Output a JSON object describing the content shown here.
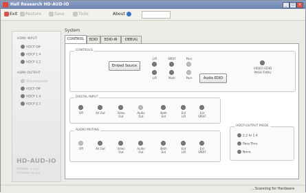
{
  "window": {
    "title": "Hall Research HD-AUD-IO",
    "controls": [
      "_",
      "□",
      "×"
    ]
  },
  "menu": {
    "items": [
      {
        "label": "Exit",
        "icon": "exit-icon",
        "disabled": false
      },
      {
        "label": "Restore",
        "icon": "restore-icon",
        "disabled": true
      },
      {
        "label": "Save",
        "icon": "save-icon",
        "disabled": true
      },
      {
        "label": "Tools",
        "icon": "tools-icon",
        "disabled": true
      },
      {
        "label": "About",
        "icon": "about-icon",
        "disabled": false
      }
    ]
  },
  "sidebar": {
    "hdmi_input_header": "HDMI INPUT",
    "hdmi_input_items": [
      {
        "label": "HDCP Off",
        "disabled": false
      },
      {
        "label": "HDCP 1.4",
        "disabled": false
      },
      {
        "label": "HDCP 2.2",
        "disabled": false
      }
    ],
    "hdmi_output_header": "HDMI OUTPUT",
    "hdmi_output_items": [
      {
        "label": "Disconnected",
        "disabled": true
      },
      {
        "label": "HDCP Off",
        "disabled": false
      },
      {
        "label": "HDCP 1.4",
        "disabled": false
      },
      {
        "label": "HDCP 2.2",
        "disabled": false
      }
    ],
    "brand": "HD-AUD-IO",
    "brand_line1": "Software: v.x.x.x",
    "brand_line2": "Firmware: v.x.x.x"
  },
  "main": {
    "group_label": "System",
    "tabs": [
      "CONTROL",
      "EDID",
      "EDID-IR",
      "DEBUG"
    ],
    "control": {
      "title": "CONTROLS",
      "embed_button": "Embed Source",
      "ledgrid": [
        {
          "label": "L/R",
          "state": "on"
        },
        {
          "label": "SPDIF",
          "state": "on"
        },
        {
          "label": "Pass",
          "state": "off"
        },
        {
          "label": "L/R",
          "state": "on"
        },
        {
          "label": "Multi",
          "state": "on"
        },
        {
          "label": "Pass",
          "state": "off"
        }
      ],
      "audio_button": "Audio EDID",
      "right_label_line1": "VIDEO EDID",
      "right_label_line2": "PASS-THRU"
    },
    "digital_input": {
      "title": "DIGITAL INPUT",
      "items": [
        {
          "l1": "Off",
          "l2": "",
          "state": "on"
        },
        {
          "l1": "AV Out",
          "l2": "",
          "state": "on"
        },
        {
          "l1": "Video",
          "l2": "Out",
          "state": "on"
        },
        {
          "l1": "Audio",
          "l2": "Out",
          "state": "off"
        },
        {
          "l1": "Both",
          "l2": "Ext",
          "state": "on"
        },
        {
          "l1": "Ext",
          "l2": "L/R",
          "state": "on"
        },
        {
          "l1": "Ext",
          "l2": "SPDIF",
          "state": "on"
        }
      ]
    },
    "audio_muting": {
      "title": "AUDIO MUTING",
      "items": [
        {
          "l1": "Off",
          "l2": "",
          "state": "off"
        },
        {
          "l1": "AV Out",
          "l2": "",
          "state": "on"
        },
        {
          "l1": "Video",
          "l2": "Out",
          "state": "on"
        },
        {
          "l1": "Audio",
          "l2": "Out",
          "state": "on"
        },
        {
          "l1": "Both",
          "l2": "Ext",
          "state": "on"
        },
        {
          "l1": "Ext",
          "l2": "L/R",
          "state": "on"
        },
        {
          "l1": "Ext",
          "l2": "SPDIF",
          "state": "on"
        }
      ]
    },
    "hdcp_output_mode": {
      "title": "HDCP OUTPUT MODE",
      "options": [
        "2.2 to 1.4",
        "Pass-Thru",
        "None"
      ]
    }
  },
  "status": {
    "text": "...Scanning for Hardware"
  }
}
